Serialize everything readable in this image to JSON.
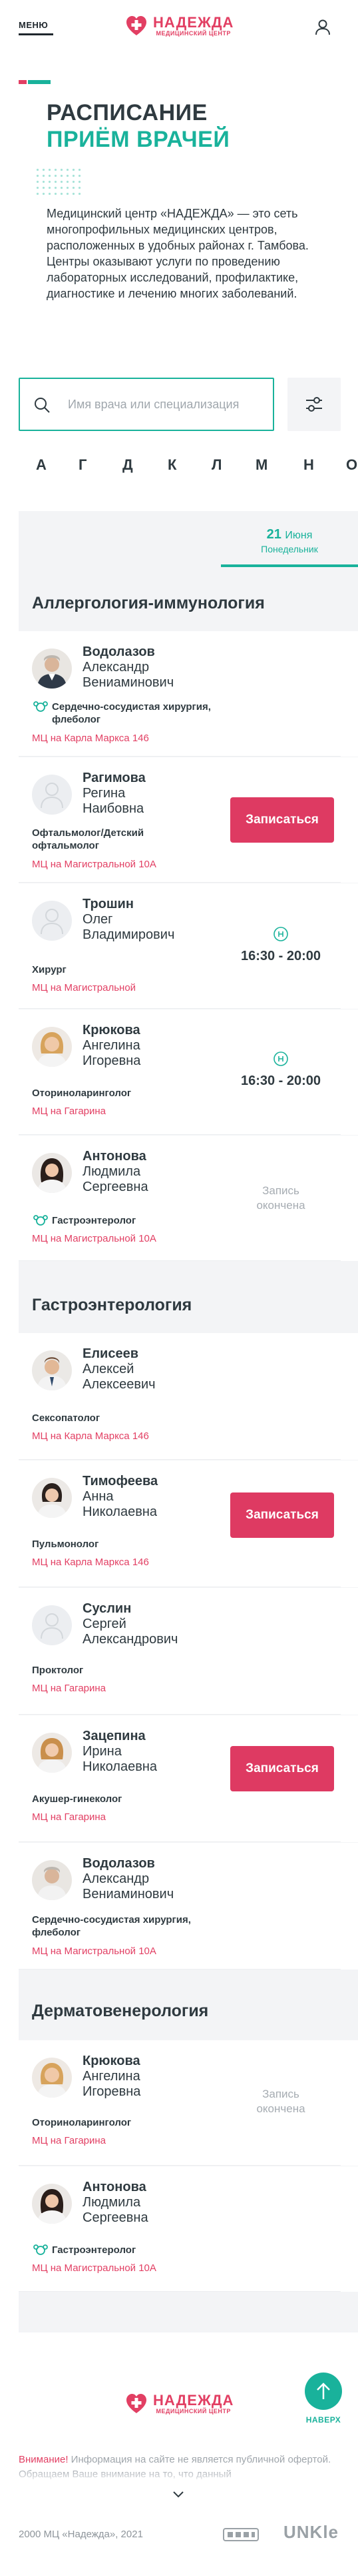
{
  "header": {
    "menu_label": "МЕНЮ",
    "logo_name": "НАДЕЖДА",
    "logo_sub": "МЕДИЦИНСКИЙ ЦЕНТР",
    "user_icon": "user-icon"
  },
  "colors": {
    "accent": "#19b29b",
    "brand": "#e23f63",
    "button": "#de3a62",
    "text": "#2f3a40"
  },
  "hero": {
    "title_line1": "РАСПИСАНИЕ",
    "title_line2": "ПРИЁМ ВРАЧЕЙ",
    "intro": "Медицинский центр «НАДЕЖДА» — это сеть многопрофильных медицинских центров, расположенных в удобных районах г. Тамбова. Центры оказывают услуги по проведению лабораторных исследований, профилактике, диагностике и лечению многих заболеваний."
  },
  "search": {
    "placeholder": "Имя врача или специализация",
    "value": ""
  },
  "alphabet": [
    "А",
    "Г",
    "Д",
    "К",
    "Л",
    "М",
    "Н",
    "О"
  ],
  "schedule": {
    "date_day": "21",
    "date_month": "Июня",
    "date_weekday": "Понедельник",
    "sections": [
      {
        "title": "Аллергология-иммунология",
        "doctors": [
          {
            "last": "Водолазов",
            "first": "Александр",
            "middle": "Вениаминович",
            "spec": "Сердечно-сосудистая хирургия, флеболог",
            "child": true,
            "address": "МЦ на Карла Маркса 146",
            "slot": ""
          },
          {
            "last": "Рагимова",
            "first": "Регина",
            "middle": "Наибовна",
            "spec": "Офтальмолог/Детский офтальмолог",
            "child": false,
            "address": "МЦ на Магистральной 10А",
            "slot": "Записаться"
          },
          {
            "last": "Трошин",
            "first": "Олег",
            "middle": "Владимирович",
            "spec": "Хирург",
            "child": false,
            "address": "МЦ на Магистральной",
            "slot": "16:30 - 20:00"
          },
          {
            "last": "Крюкова",
            "first": "Ангелина",
            "middle": "Игоревна",
            "spec": "Оториноларинголог",
            "child": false,
            "address": "МЦ на Гагарина",
            "slot": "16:30 - 20:00"
          },
          {
            "last": "Антонова",
            "first": "Людмила",
            "middle": "Сергеевна",
            "spec": "Гастроэнтеролог",
            "child": true,
            "address": "МЦ на Магистральной 10А",
            "slot": "Запись окончена"
          }
        ]
      },
      {
        "title": "Гастроэнтерология",
        "doctors": [
          {
            "last": "Елисеев",
            "first": "Алексей",
            "middle": "Алексеевич",
            "spec": "Сексопатолог",
            "child": false,
            "address": "МЦ на Карла Маркса 146",
            "slot": ""
          },
          {
            "last": "Тимофеева",
            "first": "Анна",
            "middle": "Николаевна",
            "spec": "Пульмонолог",
            "child": false,
            "address": "МЦ на Карла Маркса 146",
            "slot": "Записаться"
          },
          {
            "last": "Суслин",
            "first": "Сергей",
            "middle": "Александрович",
            "spec": "Проктолог",
            "child": false,
            "address": "МЦ на Гагарина",
            "slot": ""
          },
          {
            "last": "Зацепина",
            "first": "Ирина",
            "middle": "Николаевна",
            "spec": "Акушер-гинеколог",
            "child": false,
            "address": "МЦ на Гагарина",
            "slot": "Записаться"
          },
          {
            "last": "Водолазов",
            "first": "Александр",
            "middle": "Вениаминович",
            "spec": "Сердечно-сосудистая хирургия, флеболог",
            "child": false,
            "address": "МЦ на Магистральной 10А",
            "slot": ""
          }
        ]
      },
      {
        "title": "Дерматовенерология",
        "doctors": [
          {
            "last": "Крюкова",
            "first": "Ангелина",
            "middle": "Игоревна",
            "spec": "Оториноларинголог",
            "child": false,
            "address": "МЦ на Гагарина",
            "slot": "Запись окончена"
          },
          {
            "last": "Антонова",
            "first": "Людмила",
            "middle": "Сергеевна",
            "spec": "Гастроэнтеролог",
            "child": true,
            "address": "МЦ на Магистральной 10А",
            "slot": ""
          }
        ]
      }
    ]
  },
  "footer": {
    "logo_name": "НАДЕЖДА",
    "logo_sub": "МЕДИЦИНСКИЙ ЦЕНТР",
    "up_label": "НАВЕРХ",
    "warning_label": "Внимание!",
    "warning_text": "Информация на сайте не является публичной офертой. Обращаем Ваше внимание на то, что данный",
    "copyright": "2000 МЦ «Надежда», 2021",
    "developer": "UNKle"
  }
}
